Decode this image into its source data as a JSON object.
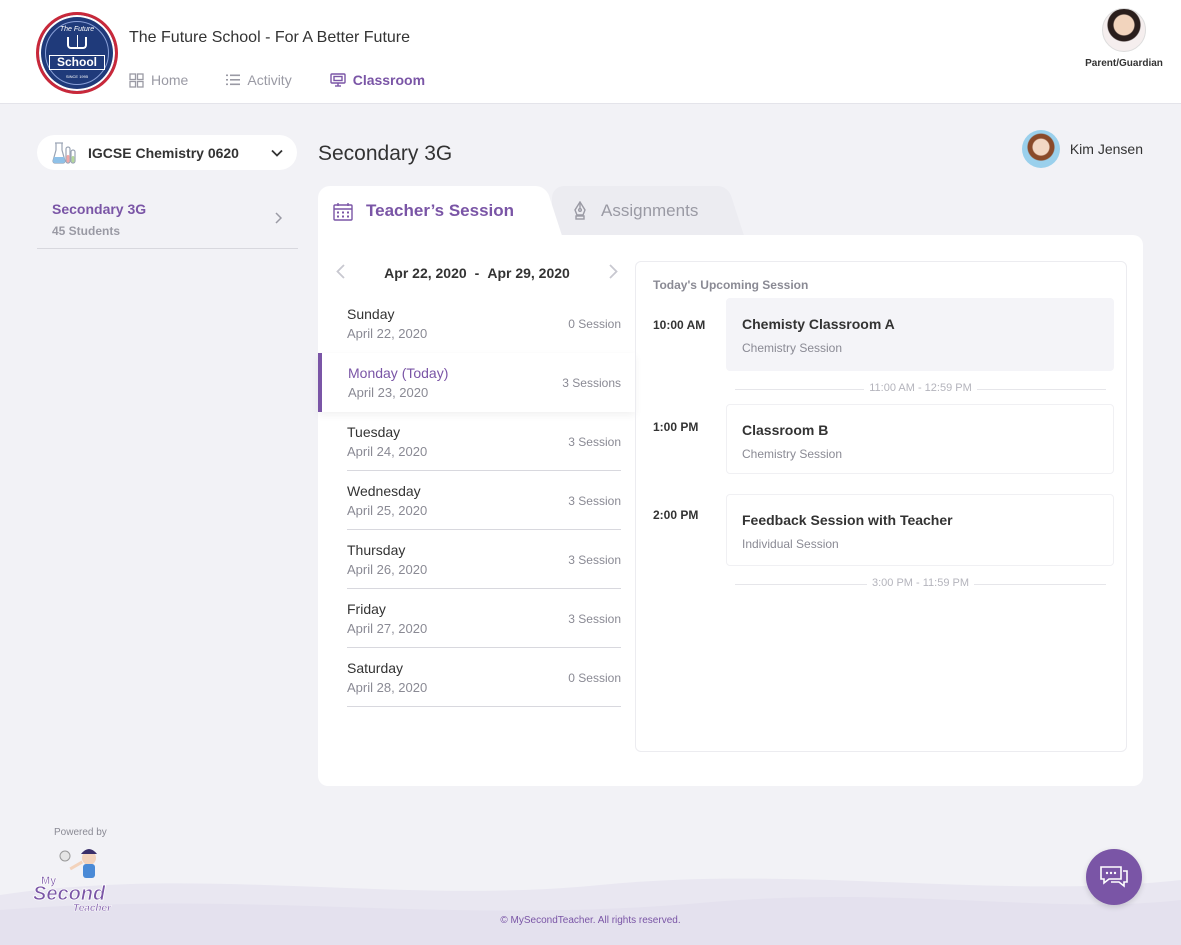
{
  "header": {
    "logo": {
      "arc_text": "The Future",
      "banner_text": "School",
      "since_text": "SINCE 1995"
    },
    "school_name": "The Future School - For A Better Future",
    "nav": [
      {
        "label": "Home",
        "icon": "grid-icon",
        "active": false
      },
      {
        "label": "Activity",
        "icon": "list-icon",
        "active": false
      },
      {
        "label": "Classroom",
        "icon": "monitor-icon",
        "active": true
      }
    ],
    "user_role": "Parent/Guardian"
  },
  "sidebar": {
    "course": "IGCSE Chemistry 0620",
    "class_name": "Secondary 3G",
    "class_count": "45 Students"
  },
  "main": {
    "title": "Secondary 3G",
    "teacher_name": "Kim Jensen",
    "tabs": [
      {
        "label": "Teacher’s Session",
        "active": true
      },
      {
        "label": "Assignments",
        "active": false
      }
    ],
    "week": {
      "start": "Apr 22, 2020",
      "separator": "-",
      "end": "Apr 29, 2020"
    },
    "days": [
      {
        "name": "Sunday",
        "date": "April 22, 2020",
        "sessions": "0 Session"
      },
      {
        "name": "Monday (Today)",
        "date": "April 23, 2020",
        "sessions": "3 Sessions"
      },
      {
        "name": "Tuesday",
        "date": "April 24, 2020",
        "sessions": "3 Session"
      },
      {
        "name": "Wednesday",
        "date": "April 25, 2020",
        "sessions": "3 Session"
      },
      {
        "name": "Thursday",
        "date": "April 26, 2020",
        "sessions": "3 Session"
      },
      {
        "name": "Friday",
        "date": "April 27, 2020",
        "sessions": "3 Session"
      },
      {
        "name": "Saturday",
        "date": "April 28, 2020",
        "sessions": "0 Session"
      }
    ],
    "upcoming": {
      "heading": "Today's Upcoming Session",
      "slots": [
        {
          "time": "10:00 AM",
          "title": "Chemisty Classroom A",
          "subtitle": "Chemistry Session"
        },
        {
          "time": "1:00 PM",
          "title": "Classroom B",
          "subtitle": "Chemistry Session"
        },
        {
          "time": "2:00 PM",
          "title": "Feedback Session with Teacher",
          "subtitle": "Individual Session"
        }
      ],
      "gaps": [
        "11:00 AM - 12:59 PM",
        "3:00 PM - 11:59 PM"
      ]
    }
  },
  "footer": {
    "powered_by": "Powered by",
    "brand": {
      "line1": "My",
      "line2": "Second",
      "line3": "Teacher"
    },
    "copyright": "© MySecondTeacher. All rights reserved."
  },
  "colors": {
    "accent": "#7a55a6",
    "background": "#f2f2f6",
    "muted": "#9a9aa4"
  }
}
